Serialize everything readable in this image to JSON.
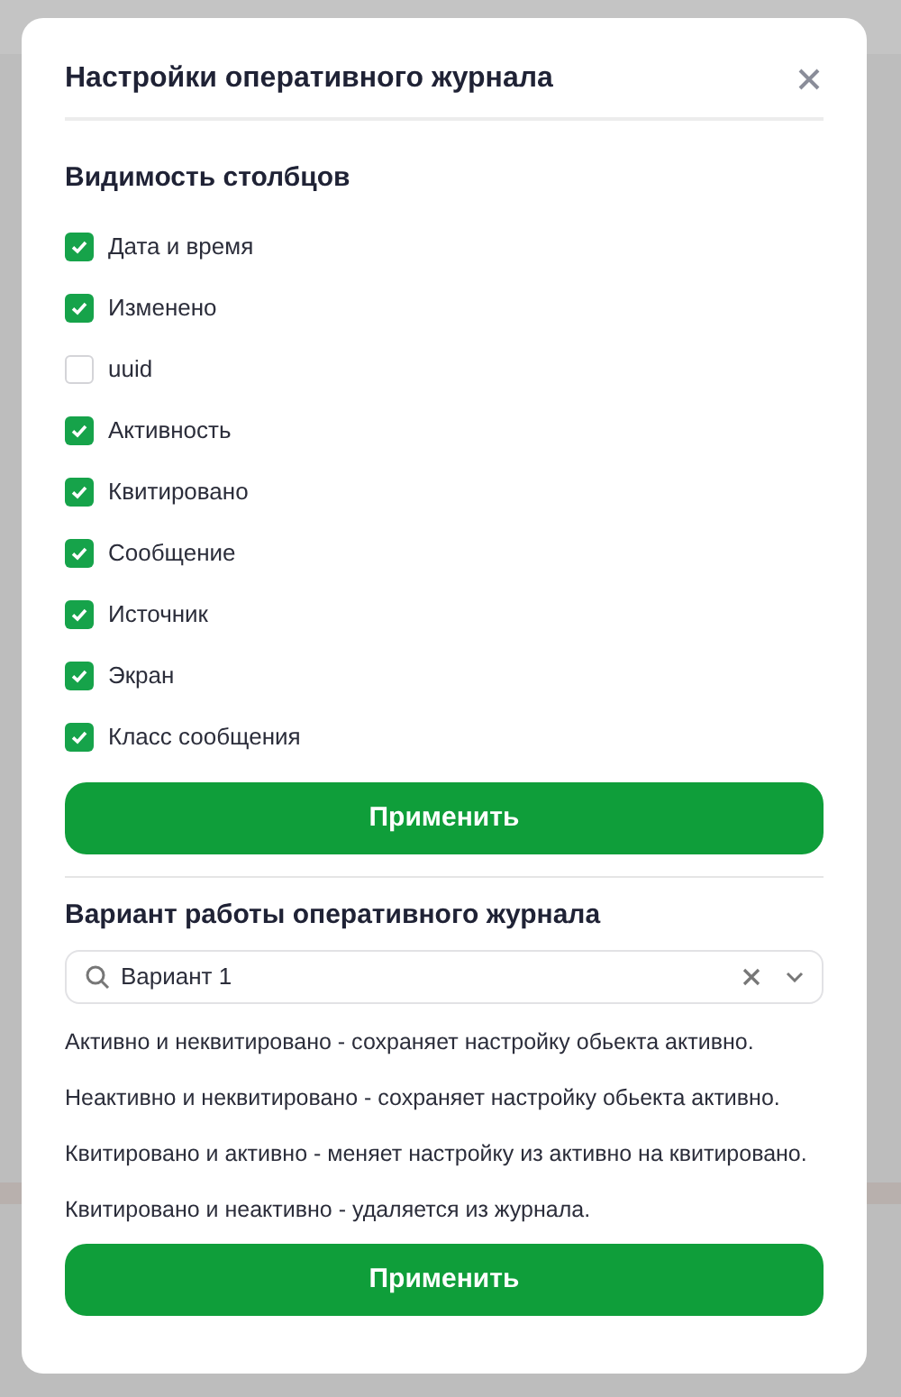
{
  "dialog": {
    "title": "Настройки оперативного журнала",
    "columns_section": {
      "title": "Видимость столбцов",
      "columns": [
        {
          "label": "Дата и время",
          "checked": true
        },
        {
          "label": "Изменено",
          "checked": true
        },
        {
          "label": "uuid",
          "checked": false
        },
        {
          "label": "Активность",
          "checked": true
        },
        {
          "label": "Квитировано",
          "checked": true
        },
        {
          "label": "Сообщение",
          "checked": true
        },
        {
          "label": "Источник",
          "checked": true
        },
        {
          "label": "Экран",
          "checked": true
        },
        {
          "label": "Класс сообщения",
          "checked": true
        }
      ],
      "apply_button": "Применить"
    },
    "mode_section": {
      "title": "Вариант работы оперативного журнала",
      "select": {
        "value": "Вариант 1"
      },
      "descriptions": [
        "Активно и неквитировано - сохраняет настройку обьекта активно.",
        "Неактивно и неквитировано - сохраняет настройку обьекта активно.",
        "Квитировано и активно - меняет настройку из активно на квитировано.",
        "Квитировано и неактивно - удаляется из журнала."
      ],
      "apply_button": "Применить"
    }
  }
}
